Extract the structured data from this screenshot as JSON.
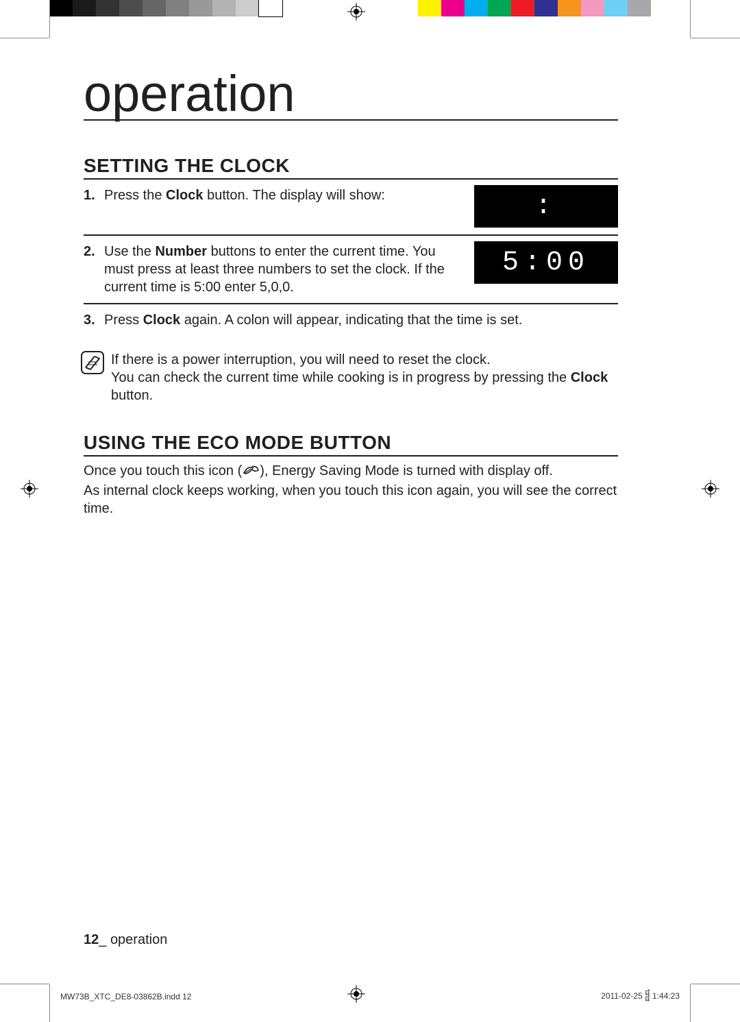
{
  "chapter_title": "operation",
  "section1": {
    "title": "SETTING THE CLOCK",
    "steps": [
      {
        "num": "1.",
        "text_pre": "Press the ",
        "bold": "Clock",
        "text_post": " button. The display will show:",
        "display": ":"
      },
      {
        "num": "2.",
        "text_pre": "Use the ",
        "bold": "Number",
        "text_post": " buttons to enter the current time. You must press at least three numbers to set the clock. If the current time is 5:00 enter 5,0,0.",
        "display": "5:00"
      },
      {
        "num": "3.",
        "text_pre": "Press ",
        "bold": "Clock",
        "text_post": " again. A colon will appear, indicating that the time is set."
      }
    ],
    "note_line1": "If there is a power interruption, you will need to reset the clock.",
    "note_line2_pre": "You can check the current time while cooking is in progress by pressing the ",
    "note_line2_bold": "Clock",
    "note_line2_post": " button."
  },
  "section2": {
    "title": "USING THE ECO MODE BUTTON",
    "para1_pre": "Once you touch this icon (",
    "para1_post": "), Energy Saving Mode is turned with display off.",
    "para2": "As internal clock keeps working, when you touch this icon again, you will see the correct time."
  },
  "footer": {
    "page_number": "12",
    "separator": "_ ",
    "section_name": "operation"
  },
  "slug": {
    "filename": "MW73B_XTC_DE8-03862B.indd   12",
    "timestamp": "2011-02-25   ᧰ 1:44:23"
  },
  "printer_bars": {
    "grays": [
      "#000000",
      "#1a1a1a",
      "#333333",
      "#4d4d4d",
      "#666666",
      "#808080",
      "#999999",
      "#b3b3b3",
      "#cccccc",
      "#ffffff"
    ],
    "colors": [
      "#fff200",
      "#ec008c",
      "#00aeef",
      "#00a651",
      "#ed1c24",
      "#2e3192",
      "#f7941d",
      "#f49ac1",
      "#6dcff6",
      "#a6a8ab"
    ]
  }
}
